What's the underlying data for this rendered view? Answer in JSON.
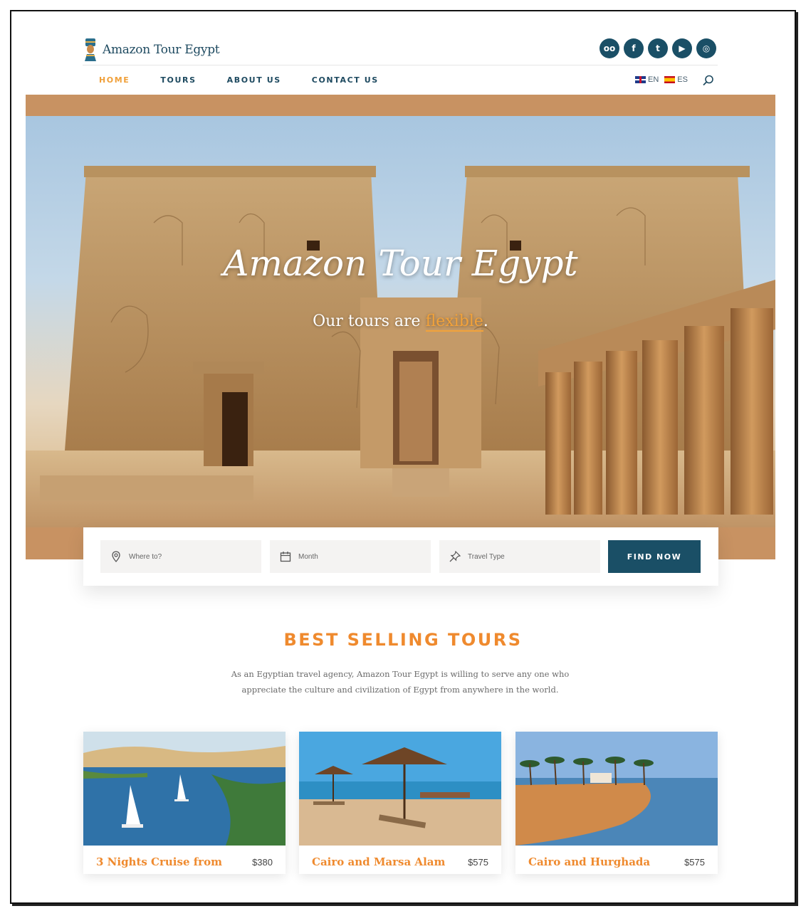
{
  "brand": {
    "name": "Amazon Tour Egypt"
  },
  "socials": [
    {
      "icon": "tripadvisor-icon",
      "glyph": "oo"
    },
    {
      "icon": "facebook-icon",
      "glyph": "f"
    },
    {
      "icon": "twitter-icon",
      "glyph": "t"
    },
    {
      "icon": "youtube-icon",
      "glyph": "▶"
    },
    {
      "icon": "instagram-icon",
      "glyph": "◎"
    }
  ],
  "nav": {
    "items": [
      "HOME",
      "TOURS",
      "ABOUT US",
      "CONTACT US"
    ],
    "active": "HOME"
  },
  "languages": [
    "EN",
    "ES"
  ],
  "hero": {
    "title": "Amazon Tour Egypt",
    "subtitle_prefix": "Our tours are ",
    "subtitle_accent": "flexible",
    "subtitle_suffix": "."
  },
  "search": {
    "where_placeholder": "Where to?",
    "month_placeholder": "Month",
    "type_placeholder": "Travel Type",
    "button": "FIND NOW"
  },
  "best_selling": {
    "title": "BEST SELLING TOURS",
    "description_line1": "As an Egyptian travel agency, Amazon Tour Egypt is willing to serve any one who",
    "description_line2": "appreciate the culture and civilization of Egypt from anywhere in the world."
  },
  "tours": [
    {
      "title": "3 Nights Cruise from",
      "price": "$380"
    },
    {
      "title": "Cairo and Marsa Alam",
      "price": "$575"
    },
    {
      "title": "Cairo and Hurghada",
      "price": "$575"
    }
  ],
  "colors": {
    "primary": "#1a4f66",
    "accent": "#ef8a2e",
    "hero_band": "#c89262"
  }
}
